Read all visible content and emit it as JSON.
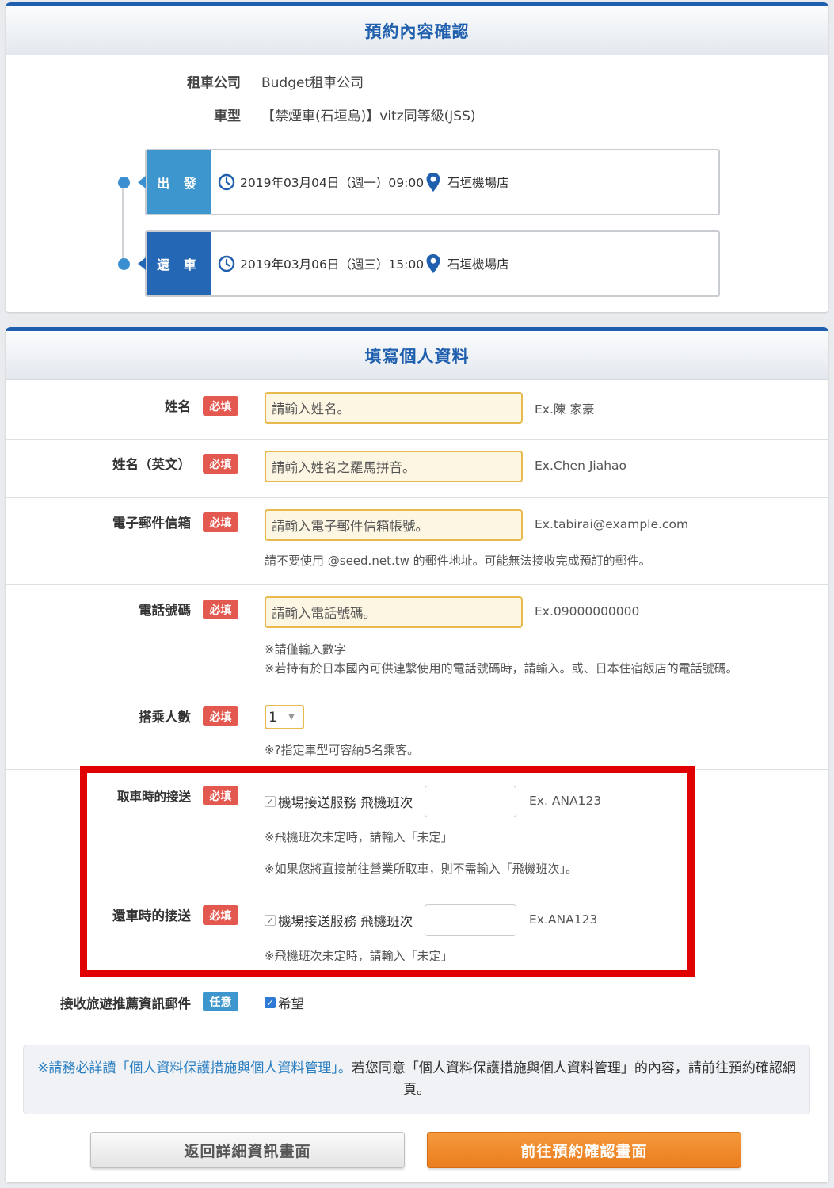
{
  "confirm": {
    "title": "預約內容確認",
    "company_label": "租車公司",
    "company_value": "Budget租車公司",
    "car_label": "車型",
    "car_value": "【禁煙車(石垣島)】vitz同等級(JSS)",
    "departure": {
      "tag": "出 發",
      "datetime": "2019年03月04日（週一）09:00",
      "location": "石垣機場店"
    },
    "return": {
      "tag": "還 車",
      "datetime": "2019年03月06日（週三）15:00",
      "location": "石垣機場店"
    }
  },
  "form": {
    "title": "填寫個人資料",
    "required_badge": "必填",
    "optional_badge": "任意",
    "name": {
      "label": "姓名",
      "placeholder": "請輸入姓名。",
      "example": "Ex.陳 家豪"
    },
    "name_en": {
      "label": "姓名（英文）",
      "placeholder": "請輸入姓名之羅馬拼音。",
      "example": "Ex.Chen Jiahao"
    },
    "email": {
      "label": "電子郵件信箱",
      "placeholder": "請輸入電子郵件信箱帳號。",
      "example": "Ex.tabirai@example.com",
      "note": "請不要使用 @seed.net.tw 的郵件地址。可能無法接收完成預訂的郵件。"
    },
    "phone": {
      "label": "電話號碼",
      "placeholder": "請輸入電話號碼。",
      "example": "Ex.09000000000",
      "note1": "※請僅輸入數字",
      "note2": "※若持有於日本國內可供連繫使用的電話號碼時，請輸入。或、日本住宿飯店的電話號碼。"
    },
    "passengers": {
      "label": "搭乘人數",
      "selected": "1",
      "note": "※?指定車型可容納5名乘客。"
    },
    "pickup_transfer": {
      "label": "取車時的接送",
      "checkbox_label": "機場接送服務 飛機班次",
      "example": "Ex. ANA123",
      "note1": "※飛機班次未定時，請輸入「未定」",
      "note2": "※如果您將直接前往營業所取車，則不需輸入「飛機班次」。"
    },
    "return_transfer": {
      "label": "還車時的接送",
      "checkbox_label": "機場接送服務 飛機班次",
      "example": "Ex.ANA123",
      "note1": "※飛機班次未定時，請輸入「未定」"
    },
    "newsletter": {
      "label": "接收旅遊推薦資訊郵件",
      "checkbox_label": "希望"
    },
    "privacy": {
      "link_text": "※請務必詳讀「個人資料保護措施與個人資料管理」。",
      "rest_text": "若您同意「個人資料保護措施與個人資料管理」的內容，請前往預約確認網頁。"
    },
    "buttons": {
      "back": "返回詳細資訊畫面",
      "next": "前往預約確認畫面"
    }
  },
  "colors": {
    "brand_blue": "#1f5fae",
    "required_red": "#e3584f",
    "optional_blue": "#3d96cd",
    "next_orange": "#ea7d1f",
    "highlight_red": "#e00000"
  }
}
